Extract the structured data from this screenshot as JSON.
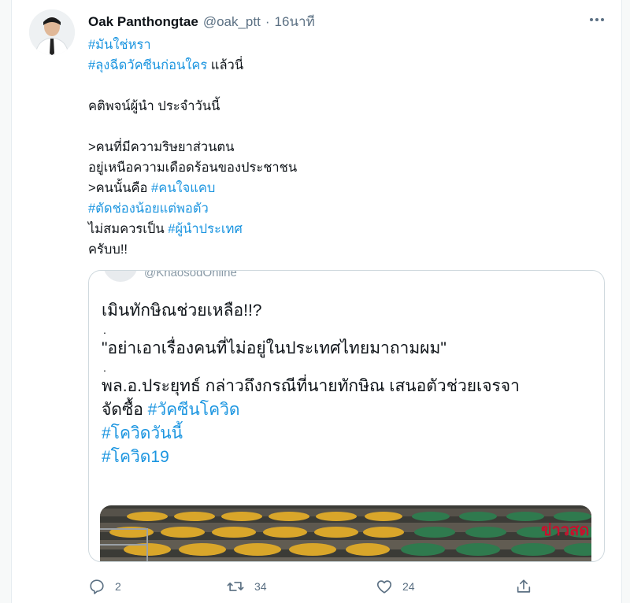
{
  "tweet": {
    "display_name": "Oak Panthongtae",
    "handle": "@oak_ptt",
    "separator": "·",
    "time": "16นาที",
    "more_icon": "more-horizontal-icon",
    "lines": [
      {
        "tag": "#มันใช่หรา",
        "text": ""
      },
      {
        "tag": "#ลุงฉีดวัคซีนก่อนใคร",
        "text": " แล้วนี่"
      },
      {
        "text": "คติพจน์ผู้นำ ประจำวันนี้"
      },
      {
        "text": ">คนที่มีความริษยาส่วนตน"
      },
      {
        "text": "อยู่เหนือความเดือดร้อนของประชาชน"
      },
      {
        "prefix": ">คนนั้นคือ ",
        "tag": "#คนใจแคบ"
      },
      {
        "tag": "#ตัดช่องน้อยแต่พอตัว"
      },
      {
        "prefix": "ไม่สมควรเป็น ",
        "tag": "#ผู้นำประเทศ"
      },
      {
        "text": "ครับบ!!"
      }
    ]
  },
  "quote": {
    "handle": "@KhaosodOnline",
    "line1": "เมินทักษิณช่วยเหลือ!!?",
    "sep1": ".",
    "line2": "\"อย่าเอาเรื่องคนที่ไม่อยู่ในประเทศไทยมาถามผม\"",
    "sep2": ".",
    "line3": "พล.อ.ประยุทธ์ กล่าวถึงกรณีที่นายทักษิณ เสนอตัวช่วยเจรจา",
    "line4_prefix": "จัดซื้อ ",
    "line4_tag": "#วัคซีนโควิด",
    "tag2": "#โควิดวันนี้",
    "tag3": "#โควิด19",
    "image_watermark": "ข่าวสด"
  },
  "actions": {
    "reply_count": "2",
    "retweet_count": "34",
    "like_count": "24"
  },
  "colors": {
    "link": "#1b95e0",
    "muted": "#5b7083",
    "border": "#cfd9de"
  }
}
